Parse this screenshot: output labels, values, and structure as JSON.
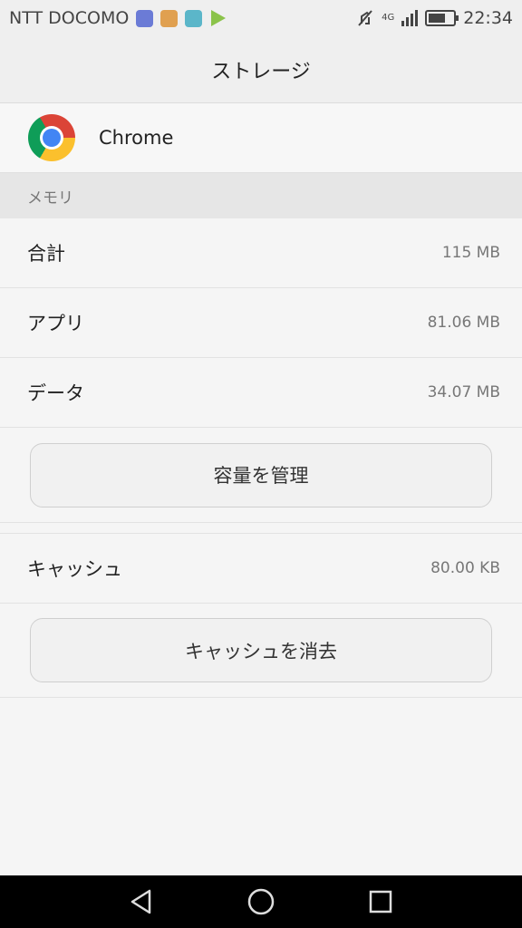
{
  "status_bar": {
    "carrier": "NTT DOCOMO",
    "network": "4G",
    "time": "22:34",
    "battery_level": 0.7
  },
  "header": {
    "title": "ストレージ"
  },
  "app": {
    "name": "Chrome",
    "icon": "chrome-logo"
  },
  "memory": {
    "section_label": "メモリ",
    "rows": [
      {
        "label": "合計",
        "value": "115 MB"
      },
      {
        "label": "アプリ",
        "value": "81.06 MB"
      },
      {
        "label": "データ",
        "value": "34.07 MB"
      }
    ],
    "manage_button": "容量を管理"
  },
  "cache": {
    "label": "キャッシュ",
    "value": "80.00 KB",
    "clear_button": "キャッシュを消去"
  },
  "nav": {
    "back_icon": "triangle-back-icon",
    "home_icon": "circle-home-icon",
    "recents_icon": "square-recents-icon"
  }
}
